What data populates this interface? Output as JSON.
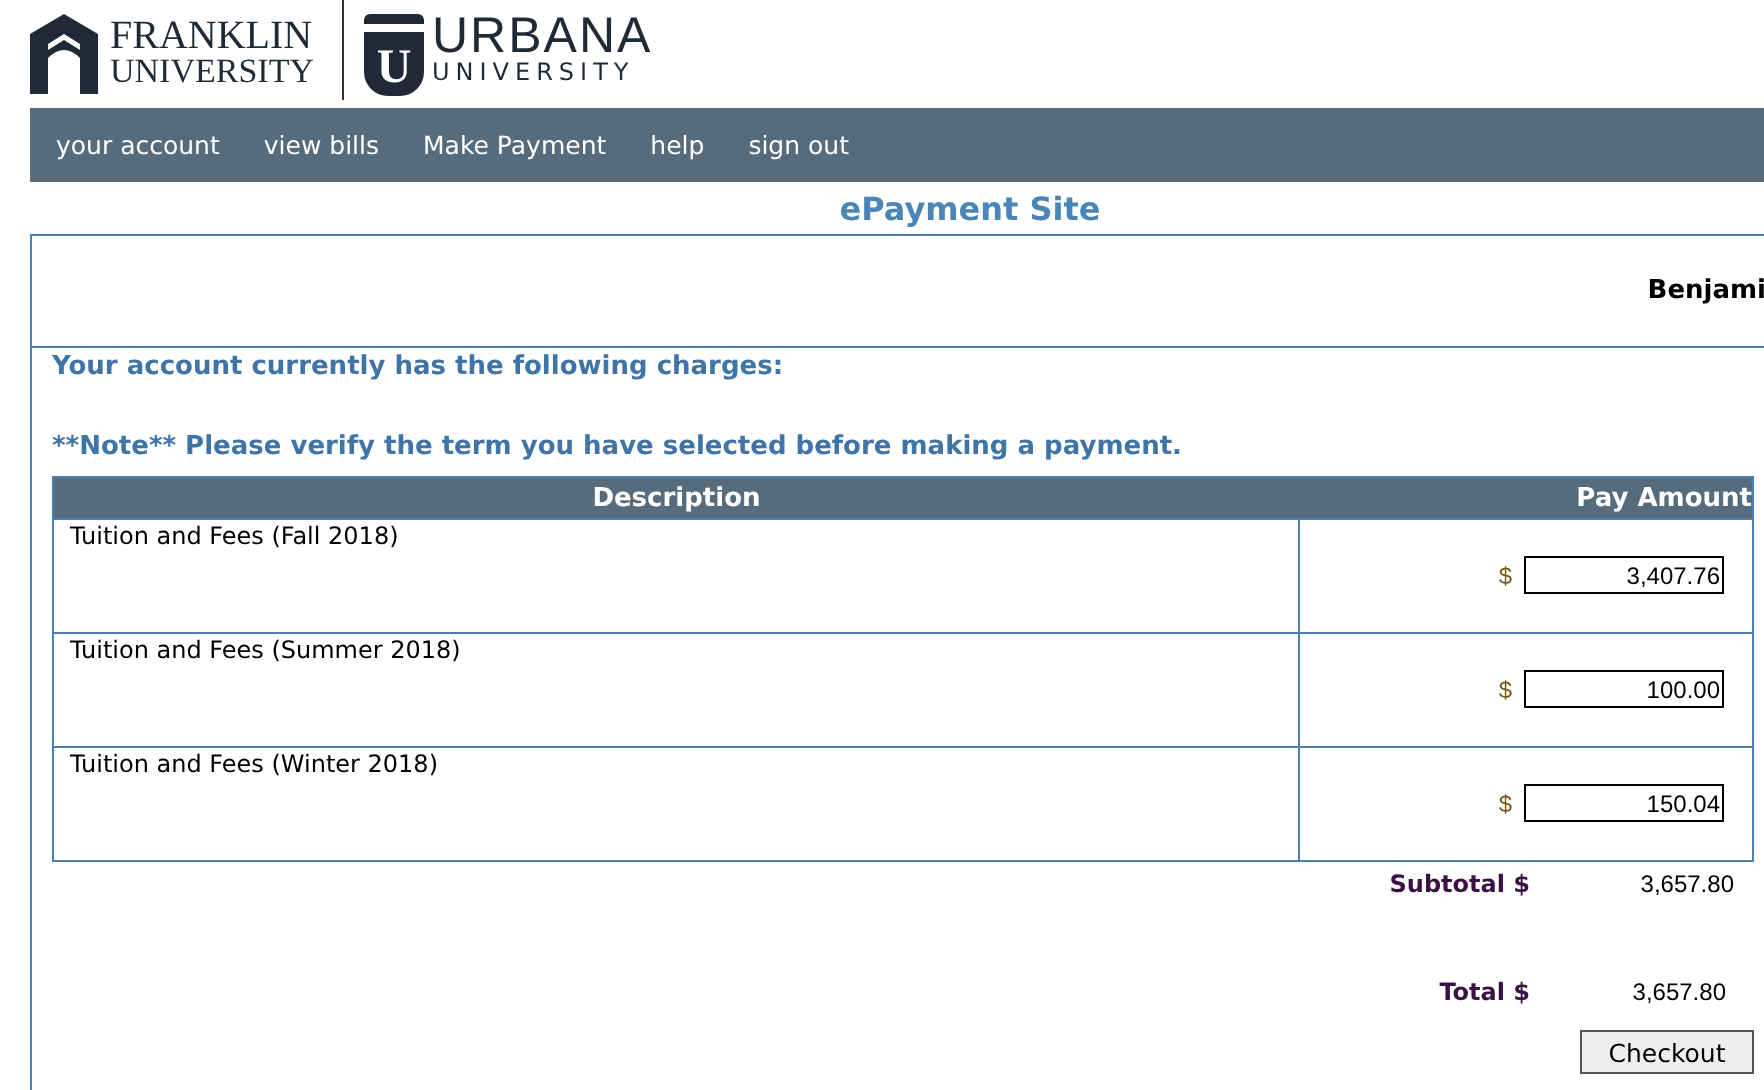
{
  "logos": {
    "franklin": [
      "FRANKLIN",
      "UNIVERSITY"
    ],
    "urbana": {
      "shield_letter": "U",
      "name": "URBANA",
      "sub": "UNIVERSITY"
    }
  },
  "nav": [
    "your account",
    "view bills",
    "Make Payment",
    "help",
    "sign out"
  ],
  "site_title": "ePayment Site",
  "user_name": "Benjami",
  "intro": "Your account currently has the following charges:",
  "note": "**Note** Please verify the term you have selected before making a payment.",
  "table": {
    "columns": [
      "Description",
      "Pay Amount"
    ],
    "rows": [
      {
        "description": "Tuition and Fees (Fall 2018)",
        "currency": "$",
        "amount": "3,407.76"
      },
      {
        "description": "Tuition and Fees (Summer 2018)",
        "currency": "$",
        "amount": "100.00"
      },
      {
        "description": "Tuition and Fees (Winter 2018)",
        "currency": "$",
        "amount": "150.04"
      }
    ]
  },
  "subtotal": {
    "label": "Subtotal $",
    "value": "3,657.80"
  },
  "total": {
    "label": "Total $",
    "value": "3,657.80"
  },
  "checkout_button": "Checkout"
}
